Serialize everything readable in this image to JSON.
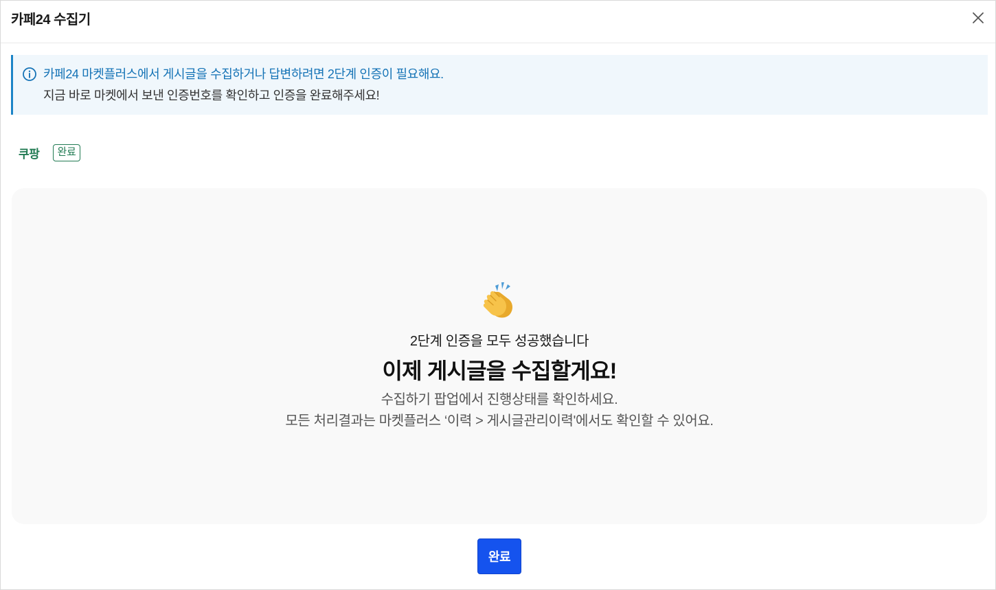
{
  "header": {
    "title": "카페24 수집기",
    "close_icon": "close-icon"
  },
  "notice": {
    "icon": "info-icon",
    "line1": "카페24 마켓플러스에서 게시글을 수집하거나 답변하려면 2단계 인증이 필요해요.",
    "line2": "지금 바로 마켓에서 보낸 인증번호를 확인하고 인증을 완료해주세요!",
    "accent_color": "#1573b6"
  },
  "market": {
    "name": "쿠팡",
    "status": "완료",
    "status_color": "#207a52"
  },
  "result": {
    "icon": "clapping-hands-icon",
    "subtitle": "2단계 인증을 모두 성공했습니다",
    "title": "이제 게시글을 수집할게요!",
    "desc1": "수집하기 팝업에서 진행상태를 확인하세요.",
    "desc2": "모든 처리결과는 마켓플러스 ‘이력 > 게시글관리이력'에서도 확인할 수 있어요."
  },
  "footer": {
    "done_label": "완료",
    "button_color": "#1553ee"
  }
}
